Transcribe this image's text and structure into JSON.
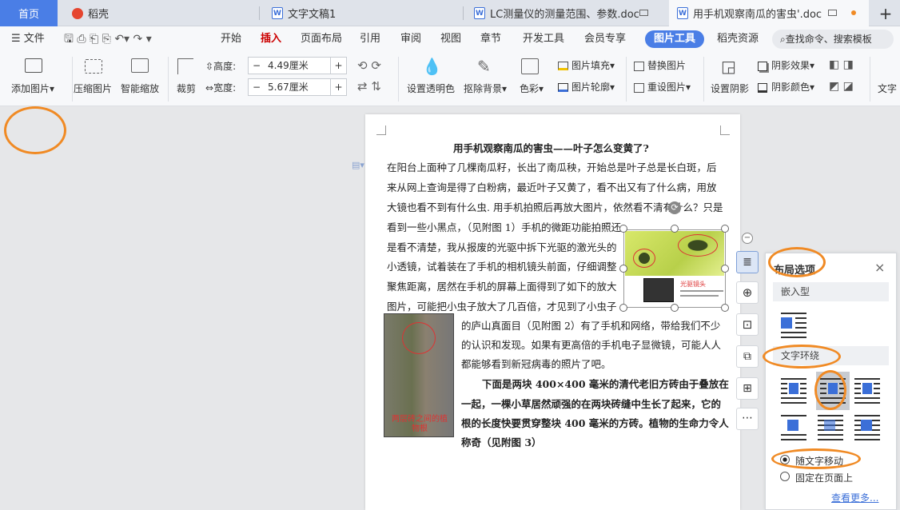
{
  "tabs": {
    "home": "首页",
    "daoke": "稻壳",
    "doc1": "文字文稿1",
    "doc2": "LC测量仪的测量范围、参数.doc",
    "doc3": "用手机观察南瓜的害虫'.doc",
    "add": "+"
  },
  "menu": {
    "file": "文件",
    "items": [
      "开始",
      "插入",
      "页面布局",
      "引用",
      "审阅",
      "视图",
      "章节",
      "开发工具",
      "会员专享"
    ],
    "active": "图片工具",
    "resources": "稻壳资源",
    "search": "查找命令、搜索模板"
  },
  "ribbon": {
    "add_picture": "添加图片",
    "compress": "压缩图片",
    "smart_zoom": "智能缩放",
    "crop": "裁剪",
    "height_label": "高度:",
    "height_value": "4.49厘米",
    "width_label": "宽度:",
    "width_value": "5.67厘米",
    "transparent": "设置透明色",
    "remove_bg": "抠除背景",
    "color": "色彩",
    "fill": "图片填充",
    "outline": "图片轮廓",
    "replace": "替换图片",
    "reset": "重设图片",
    "shadow_set": "设置阴影",
    "shadow_effect": "阴影效果",
    "shadow_color": "阴影颜色",
    "text_tool": "文字"
  },
  "document": {
    "title": "用手机观察南瓜的害虫——叶子怎么变黄了?",
    "lines": [
      "在阳台上面种了几棵南瓜籽，长出了南瓜秧，开始总是叶子总是长白斑，后",
      "来从网上查询是得了白粉病，最近叶子又黄了，看不出又有了什么病，用放",
      "大镜也看不到有什么虫. 用手机拍照后再放大图片，依然看不清有什么？只是",
      "看到一些小黑点，（见附图 1）手机的微距功能拍照还",
      "是看不清楚，我从报废的光驱中拆下光驱的激光头的",
      "小透镜，试着装在了手机的相机镜头前面，仔细调整",
      "聚焦距离，居然在手机的屏幕上面得到了如下的放大",
      "图片，可能把小虫子放大了几百倍，才见到了小虫子",
      "的庐山真面目（见附图 2）有了手机和网络，带给我们不少",
      "的认识和发现。如果有更高倍的手机电子显微镜，可能人人",
      "都能够看到新冠病毒的照片了吧。"
    ],
    "bold_lines": [
      "下面是两块 400×400 毫米的清代老旧方砖由于叠放在",
      "一起，一棵小草居然顽强的在两块砖缝中生长了起来，它的",
      "根的长度快要贯穿整块 400 毫米的方砖。植物的生命力令人",
      "称奇（见附图 3）"
    ],
    "img_caption": "光驱镜头",
    "img2_caption": "两层砖之间的植物根"
  },
  "panel": {
    "title": "布局选项",
    "inline": "嵌入型",
    "wrap": "文字环绕",
    "move_with_text": "随文字移动",
    "fix_on_page": "固定在页面上",
    "more": "查看更多..."
  },
  "colors": {
    "accent": "#4a7ee6",
    "highlight": "#f08a24"
  }
}
